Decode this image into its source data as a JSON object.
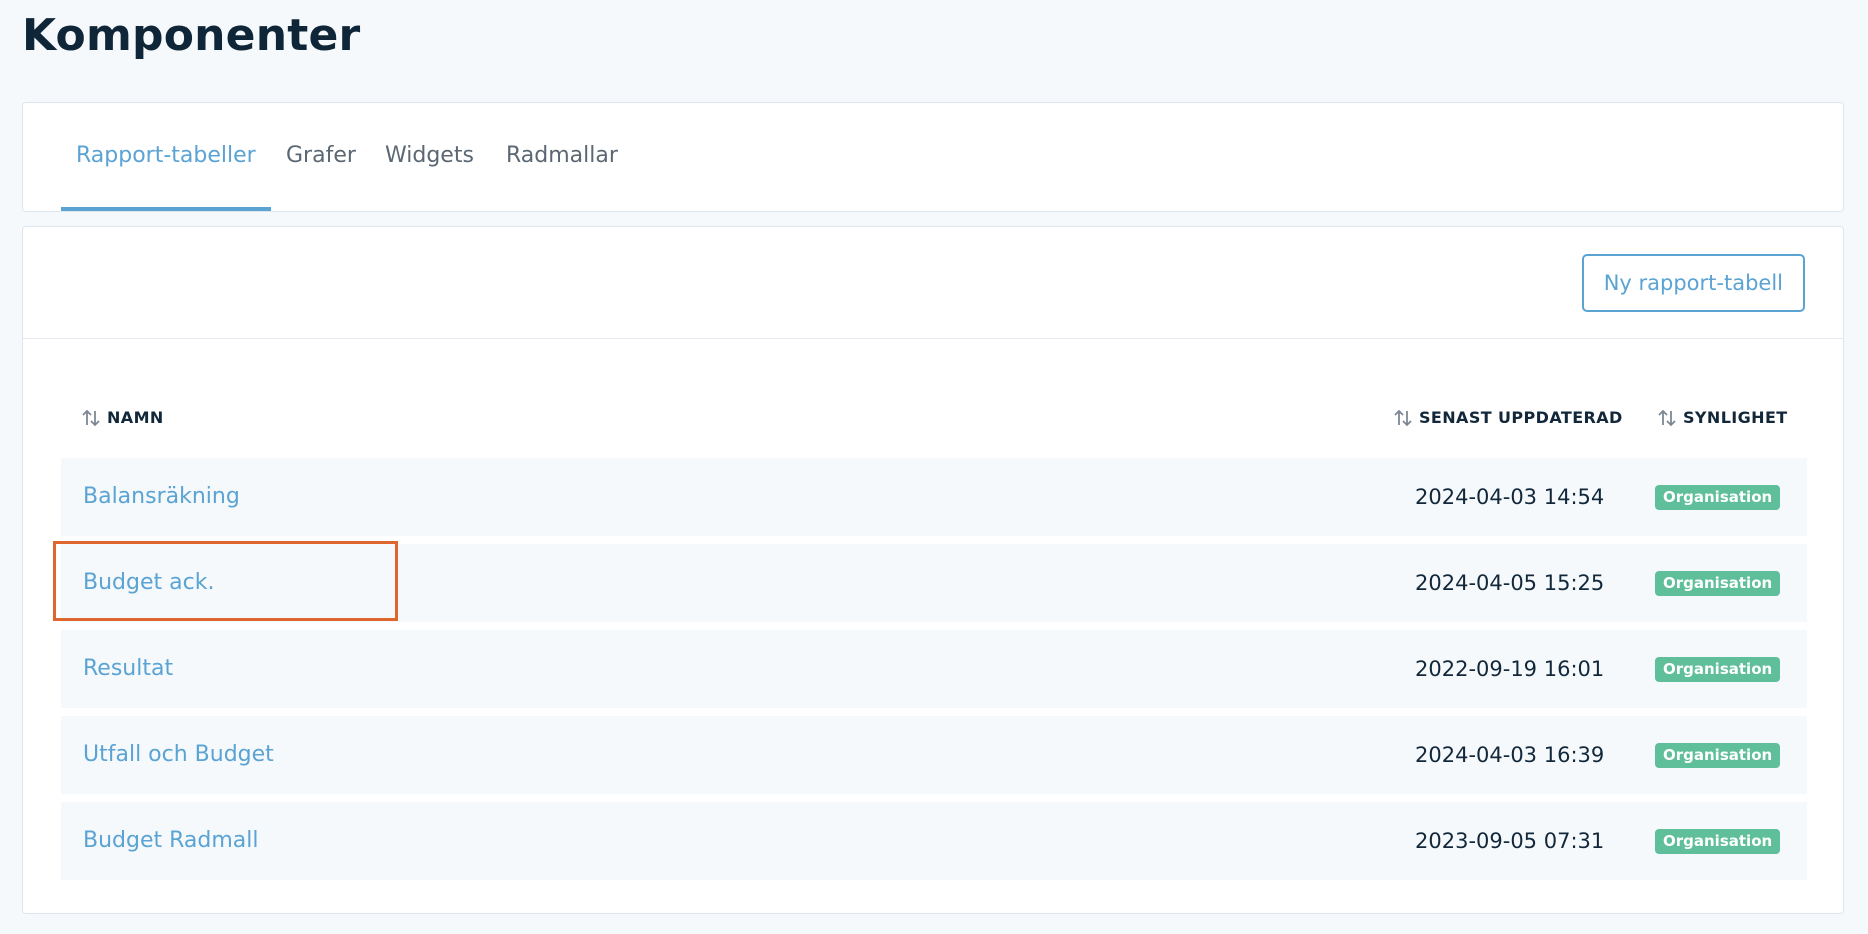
{
  "page": {
    "title": "Komponenter"
  },
  "tabs": [
    {
      "label": "Rapport-tabeller",
      "active": true
    },
    {
      "label": "Grafer",
      "active": false
    },
    {
      "label": "Widgets",
      "active": false
    },
    {
      "label": "Radmallar",
      "active": false
    }
  ],
  "toolbar": {
    "new_button_label": "Ny rapport-tabell"
  },
  "table": {
    "headers": {
      "name": "NAMN",
      "updated": "SENAST UPPDATERAD",
      "visibility": "SYNLIGHET"
    },
    "rows": [
      {
        "name": "Balansräkning",
        "updated": "2024-04-03 14:54",
        "visibility": "Organisation"
      },
      {
        "name": "Budget ack.",
        "updated": "2024-04-05 15:25",
        "visibility": "Organisation"
      },
      {
        "name": "Resultat",
        "updated": "2022-09-19 16:01",
        "visibility": "Organisation"
      },
      {
        "name": "Utfall och Budget",
        "updated": "2024-04-03 16:39",
        "visibility": "Organisation"
      },
      {
        "name": "Budget Radmall",
        "updated": "2023-09-05 07:31",
        "visibility": "Organisation"
      }
    ]
  },
  "colors": {
    "accent": "#5aa3d3",
    "badge": "#5fbf9b",
    "highlight": "#e0662f",
    "background": "#f5f9fc"
  }
}
